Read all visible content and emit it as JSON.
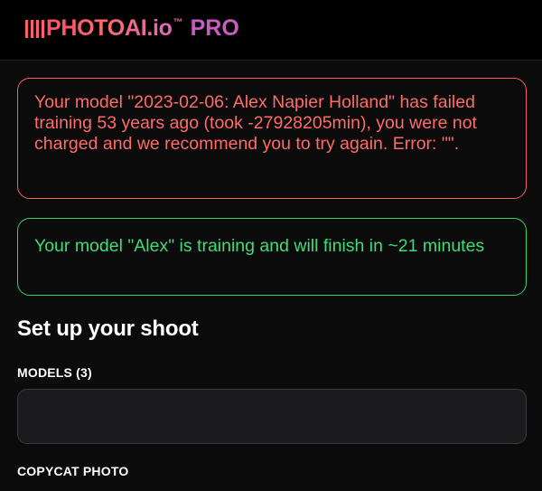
{
  "header": {
    "logo_text": "PHOTOAI.io",
    "logo_tm": "™",
    "logo_pro": "PRO"
  },
  "alerts": {
    "error": {
      "text": "Your model \"2023-02-06: Alex Napier Holland\" has failed training 53 years ago (took -27928205min), you were not charged and we recommend you to try again. Error: \"\".",
      "color": "#ff6b67"
    },
    "success": {
      "text": "Your model \"Alex\" is training and will finish in ~21 minutes",
      "color": "#3fdc77"
    }
  },
  "main": {
    "section_title": "Set up your shoot",
    "models_label": "MODELS (3)",
    "models_value": "",
    "copycat_label": "COPYCAT PHOTO"
  }
}
